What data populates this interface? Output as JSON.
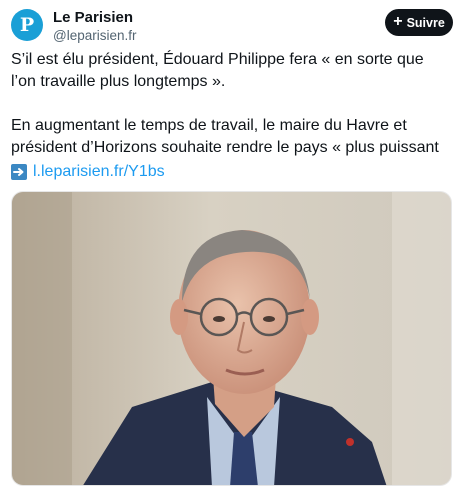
{
  "account": {
    "avatar_letter": "P",
    "name": "Le Parisien",
    "handle": "@leparisien.fr"
  },
  "follow_button": {
    "label": "Suivre"
  },
  "post": {
    "paragraph1": "S’il est élu président, Édouard Philippe fera « en sorte que l’on travaille plus longtemps ».",
    "paragraph2": "En augmentant le temps de travail, le maire du Havre et président d’Horizons souhaite rendre le pays « plus puissant ».",
    "link_icon": "right-arrow-emoji",
    "link_text": "l.leparisien.fr/Y1bs"
  },
  "colors": {
    "brand_avatar": "#1a9fd6",
    "link": "#1d9bf0",
    "follow_bg": "#0f1419"
  }
}
